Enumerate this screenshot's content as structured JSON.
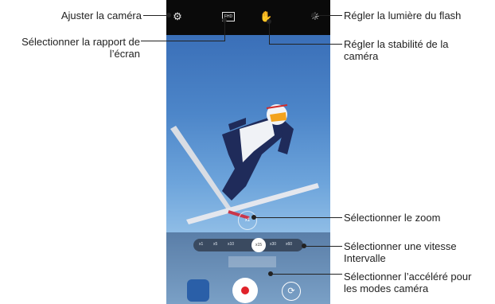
{
  "camera": {
    "fhd_label": "FHD",
    "zoom_label": "x1",
    "speeds": [
      "x1",
      "x5",
      "x10",
      "x15",
      "x30",
      "x60"
    ],
    "selected_speed": "x15"
  },
  "callouts": {
    "settings": "Ajuster la caméra",
    "ratio": "Sélectionner la rapport de\nl’écran",
    "flash": "Régler la lumière du flash",
    "stability": "Régler la stabilité de la\ncaméra",
    "zoom": "Sélectionner le zoom",
    "speed": "Sélectionner une vitesse\nIntervalle",
    "modes": "Sélectionner l’accéléré pour\nles modes caméra"
  }
}
